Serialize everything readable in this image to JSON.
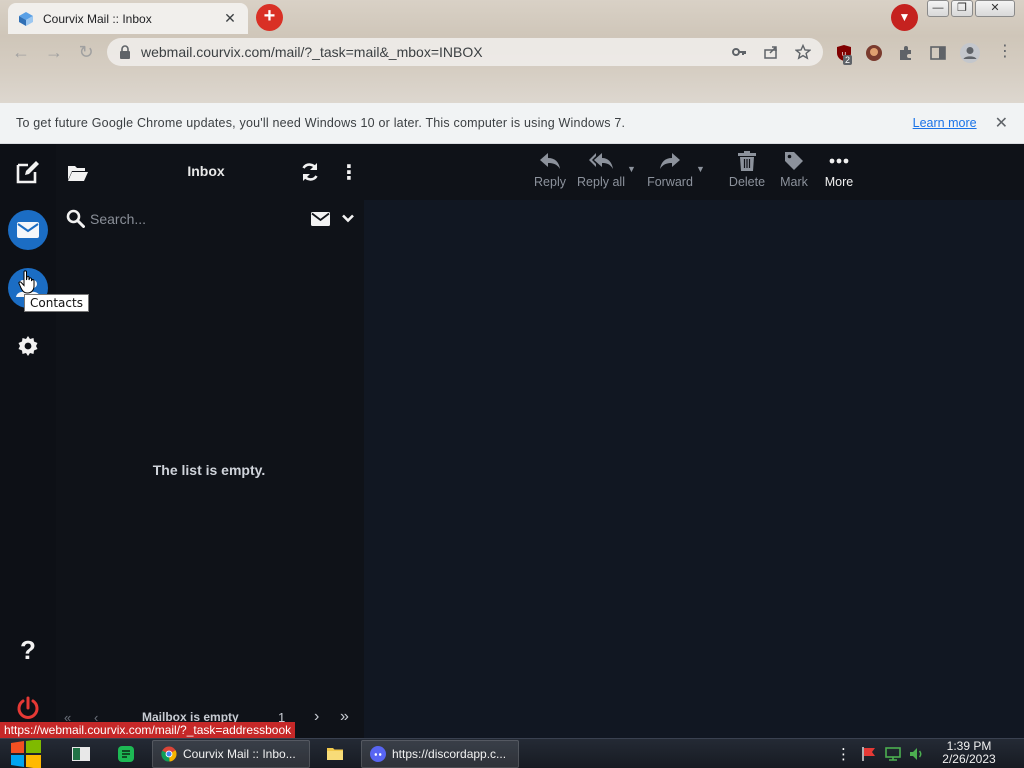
{
  "browser": {
    "tab_title": "Courvix Mail :: Inbox",
    "url": "webmail.courvix.com/mail/?_task=mail&_mbox=INBOX",
    "extension_badge": "2",
    "window_controls": {
      "minimize": "—",
      "restore": "❐",
      "close": "✕"
    }
  },
  "infobar": {
    "message": "To get future Google Chrome updates, you'll need Windows 10 or later. This computer is using Windows 7.",
    "link": "Learn more"
  },
  "webmail": {
    "rail": {
      "compose_icon": "compose-icon",
      "mail_icon": "envelope-icon",
      "contacts_icon": "people-icon",
      "settings_icon": "gear-icon",
      "help_icon": "question-icon",
      "logout_icon": "power-icon",
      "contacts_tooltip": "Contacts"
    },
    "list": {
      "title": "Inbox",
      "search_placeholder": "Search...",
      "empty_message": "The list is empty.",
      "pager_text": "Mailbox is empty",
      "page_number": "1"
    },
    "actions": [
      {
        "label": "Reply",
        "icon": "reply-icon"
      },
      {
        "label": "Reply all",
        "icon": "reply-all-icon"
      },
      {
        "label": "Forward",
        "icon": "forward-icon"
      },
      {
        "label": "Delete",
        "icon": "trash-icon"
      },
      {
        "label": "Mark",
        "icon": "tag-icon"
      },
      {
        "label": "More",
        "icon": "more-icon"
      }
    ]
  },
  "status_bar": {
    "url": "https://webmail.courvix.com/mail/?_task=addressbook"
  },
  "taskbar": {
    "tasks": [
      {
        "label": "Courvix Mail :: Inbo...",
        "icon": "chrome-icon"
      },
      {
        "label": "https://discordapp.c...",
        "icon": "discord-icon"
      }
    ],
    "clock_time": "1:39 PM",
    "clock_date": "2/26/2023"
  },
  "colors": {
    "accent": "#1b6dc4",
    "app_background": "#0f1218",
    "logout_red": "#e53935",
    "chrome_red": "#d93025"
  }
}
